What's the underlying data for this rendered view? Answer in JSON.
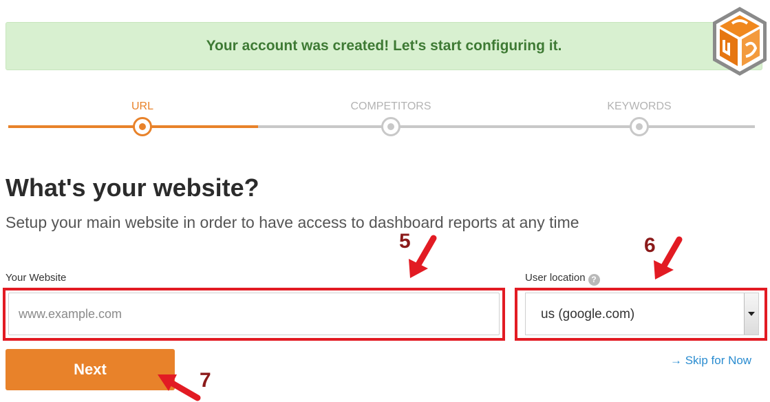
{
  "banner": {
    "message": "Your account was created! Let's start configuring it."
  },
  "logo": {
    "icon": "hexagon-cube-logo",
    "color": "#f0881e"
  },
  "steps": [
    {
      "label": "URL",
      "active": true
    },
    {
      "label": "COMPETITORS",
      "active": false
    },
    {
      "label": "KEYWORDS",
      "active": false
    }
  ],
  "page": {
    "title": "What's your website?",
    "subtitle": "Setup your main website in order to have access to dashboard reports at any time"
  },
  "form": {
    "website_label": "Your Website",
    "website_placeholder": "www.example.com",
    "location_label": "User location",
    "location_help_icon": "question-circle-icon",
    "location_value": "us (google.com)",
    "next_label": "Next",
    "skip_label": "→ Skip for Now"
  },
  "annotations": [
    "5",
    "6",
    "7"
  ],
  "colors": {
    "accent": "#e8822a",
    "banner_bg": "#d8f0d0",
    "banner_text": "#3e7a34",
    "highlight": "#e21b23",
    "link": "#2a8cd0"
  }
}
